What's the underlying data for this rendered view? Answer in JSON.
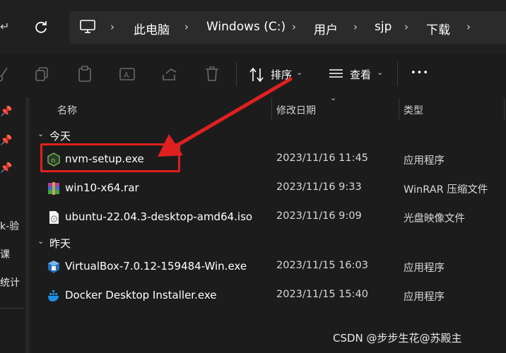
{
  "breadcrumb": [
    "此电脑",
    "Windows (C:)",
    "用户",
    "sjp",
    "下载"
  ],
  "toolbar": {
    "sort_label": "排序",
    "view_label": "查看",
    "more_label": "•••"
  },
  "sidebar": {
    "frag1": "k-验",
    "frag2": "课",
    "frag3": "统计"
  },
  "columns": {
    "name": "名称",
    "date": "修改日期",
    "type": "类型"
  },
  "groups": [
    {
      "label": "今天",
      "files": [
        {
          "name": "nvm-setup.exe",
          "date": "2023/11/16 11:45",
          "type": "应用程序",
          "icon": "nvm-icon"
        },
        {
          "name": "win10-x64.rar",
          "date": "2023/11/16 9:33",
          "type": "WinRAR 压缩文件",
          "icon": "winrar-icon"
        },
        {
          "name": "ubuntu-22.04.3-desktop-amd64.iso",
          "date": "2023/11/16 9:09",
          "type": "光盘映像文件",
          "icon": "disc-image-icon"
        }
      ]
    },
    {
      "label": "昨天",
      "files": [
        {
          "name": "VirtualBox-7.0.12-159484-Win.exe",
          "date": "2023/11/15 16:03",
          "type": "应用程序",
          "icon": "virtualbox-icon"
        },
        {
          "name": "Docker Desktop Installer.exe",
          "date": "2023/11/15 15:40",
          "type": "应用程序",
          "icon": "docker-icon"
        }
      ]
    }
  ],
  "annotation": {
    "color": "#e0201f"
  },
  "watermark": "CSDN @步步生花@苏殿主"
}
